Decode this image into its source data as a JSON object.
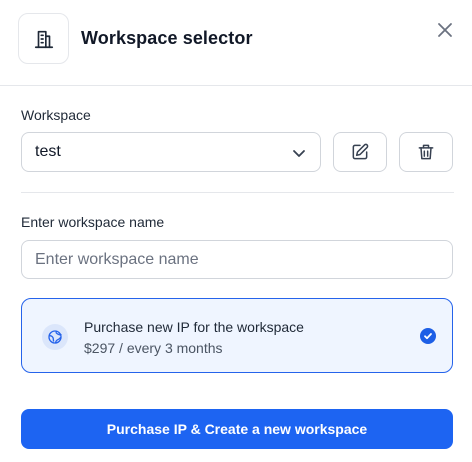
{
  "dialog": {
    "title": "Workspace selector",
    "header_icon": "building-icon",
    "close_icon": "close-icon"
  },
  "workspace": {
    "label": "Workspace",
    "selected": "test",
    "edit_icon": "edit-icon",
    "delete_icon": "trash-icon"
  },
  "new_workspace": {
    "label": "Enter workspace name",
    "placeholder": "Enter workspace name",
    "value": ""
  },
  "purchase_option": {
    "title": "Purchase new IP for the workspace",
    "price": "$297 / every 3 months",
    "icon": "globe-icon",
    "selected": true
  },
  "submit": {
    "label": "Purchase IP & Create a new workspace"
  },
  "colors": {
    "accent": "#1d64f2",
    "card_bg": "#eff5ff",
    "border": "#d1d5db"
  }
}
